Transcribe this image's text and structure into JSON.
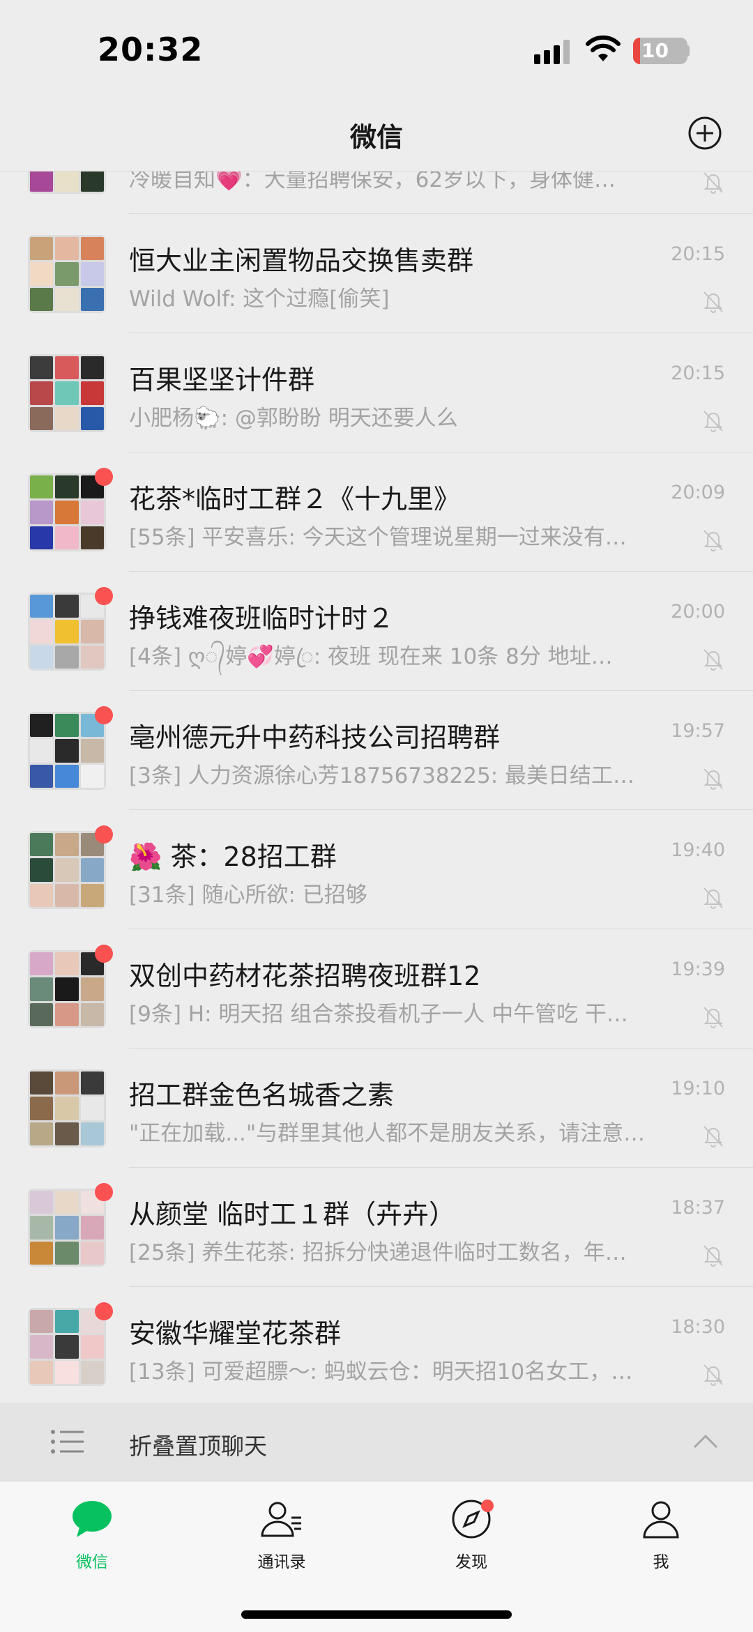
{
  "status_bar": {
    "time": "20:32",
    "battery": "10"
  },
  "nav": {
    "title": "微信"
  },
  "partial_row": {
    "preview": "冷暖自知💗：大量招聘保安，62岁以下，身体健…"
  },
  "chats": [
    {
      "title": "恒大业主闲置物品交换售卖群",
      "preview": "Wild Wolf: 这个过瘾[偷笑]",
      "time": "20:15",
      "unread": false,
      "avatar_colors": [
        "#c9a27a",
        "#e3b7a0",
        "#d8825c",
        "#f1d9c4",
        "#7a9a6b",
        "#c8c8e8",
        "#5b7a4a",
        "#e8e0d0",
        "#3a6fb0"
      ]
    },
    {
      "title": "百果坚坚计件群",
      "preview": "小肥杨🐑: @郭盼盼 明天还要人么",
      "time": "20:15",
      "unread": false,
      "avatar_colors": [
        "#3c3c3c",
        "#d85a5a",
        "#2a2a2a",
        "#b8484a",
        "#6fc7b8",
        "#c83838",
        "#8a6a5a",
        "#e8d8c8",
        "#2858a8"
      ]
    },
    {
      "title": "花茶*临时工群２《十九里》",
      "preview": "[55条] 平安喜乐: 今天这个管理说星期一过来没有…",
      "time": "20:09",
      "unread": true,
      "avatar_colors": [
        "#7ab04a",
        "#2a3a2a",
        "#1a1a1a",
        "#b898c8",
        "#d87838",
        "#e8c8d8",
        "#2838a8",
        "#f0b8c8",
        "#4a3a2a"
      ]
    },
    {
      "title": "挣钱难夜班临时计时２",
      "preview": "[4条] ღ᭄婷💞婷ꦿ: 夜班 现在来 10条 8分 地址…",
      "time": "20:00",
      "unread": true,
      "avatar_colors": [
        "#5898d8",
        "#3a3a3a",
        "#e8e8e8",
        "#f0d8d8",
        "#f0c030",
        "#d8b8a8",
        "#c8d8e8",
        "#a8a8a8",
        "#e0c8c0"
      ]
    },
    {
      "title": "亳州德元升中药科技公司招聘群",
      "preview": "[3条] 人力资源徐心芳18756738225: 最美日结工…",
      "time": "19:57",
      "unread": true,
      "avatar_colors": [
        "#202020",
        "#3a8a5a",
        "#7ab8d8",
        "#e8e8e8",
        "#2a2a2a",
        "#c8b8a8",
        "#3858a8",
        "#4888d8",
        "#f0f0f0"
      ]
    },
    {
      "title": "🌺 茶：28招工群",
      "preview": "[31条] 随心所欲: 已招够",
      "time": "19:40",
      "unread": true,
      "avatar_colors": [
        "#4a7a5a",
        "#c8a888",
        "#9a8a7a",
        "#2a4a3a",
        "#d8c8b8",
        "#88a8c8",
        "#e8c8b8",
        "#d8b8a8",
        "#c8a878"
      ]
    },
    {
      "title": "双创中药材花茶招聘夜班群12",
      "preview": "[9条] H: 明天招 组合茶投看机子一人 中午管吃 干…",
      "time": "19:39",
      "unread": true,
      "avatar_colors": [
        "#d8a8c8",
        "#e8c8b8",
        "#2a2a2a",
        "#6a8a7a",
        "#1a1a1a",
        "#c8a888",
        "#5a6a5a",
        "#d89888",
        "#c8b8a8"
      ]
    },
    {
      "title": "招工群金色名城香之素",
      "preview": "\"正在加载...\"与群里其他人都不是朋友关系，请注意…",
      "time": "19:10",
      "unread": false,
      "avatar_colors": [
        "#5a4a3a",
        "#c89878",
        "#3a3a3a",
        "#8a6a4a",
        "#d8c8a8",
        "#e8e8e8",
        "#b8a888",
        "#6a5a4a",
        "#a8c8d8"
      ]
    },
    {
      "title": "从颜堂  临时工１群（卉卉）",
      "preview": "[25条] 养生花茶: 招拆分快递退件临时工数名，年…",
      "time": "18:37",
      "unread": true,
      "avatar_colors": [
        "#d8c8d8",
        "#e8d8c8",
        "#f0e0e0",
        "#a8b8a8",
        "#88a8c8",
        "#d8a8b8",
        "#c88838",
        "#6a8a6a",
        "#e8c8c8"
      ]
    },
    {
      "title": "安徽华耀堂花茶群",
      "preview": "[13条] 可爱超膘～: 蚂蚁云仓：明天招10名女工，…",
      "time": "18:30",
      "unread": true,
      "avatar_colors": [
        "#c8a8a8",
        "#48a8a8",
        "#e8d8d8",
        "#d8b8c8",
        "#3a3a3a",
        "#f0c8c8",
        "#e8c8b8",
        "#f8e0e0",
        "#d8d0c8"
      ]
    }
  ],
  "fold": {
    "label": "折叠置顶聊天"
  },
  "tabbar": {
    "chats": "微信",
    "contacts": "通讯录",
    "discover": "发现",
    "me": "我"
  },
  "colors": {
    "accent": "#07c160",
    "badge": "#fa5151"
  },
  "icons": [
    "signal-icon",
    "wifi-icon",
    "battery-icon",
    "plus-circle-icon",
    "mute-bell-icon",
    "list-icon",
    "chevron-up-icon",
    "chat-bubble-icon",
    "contacts-icon",
    "compass-icon",
    "person-icon"
  ]
}
